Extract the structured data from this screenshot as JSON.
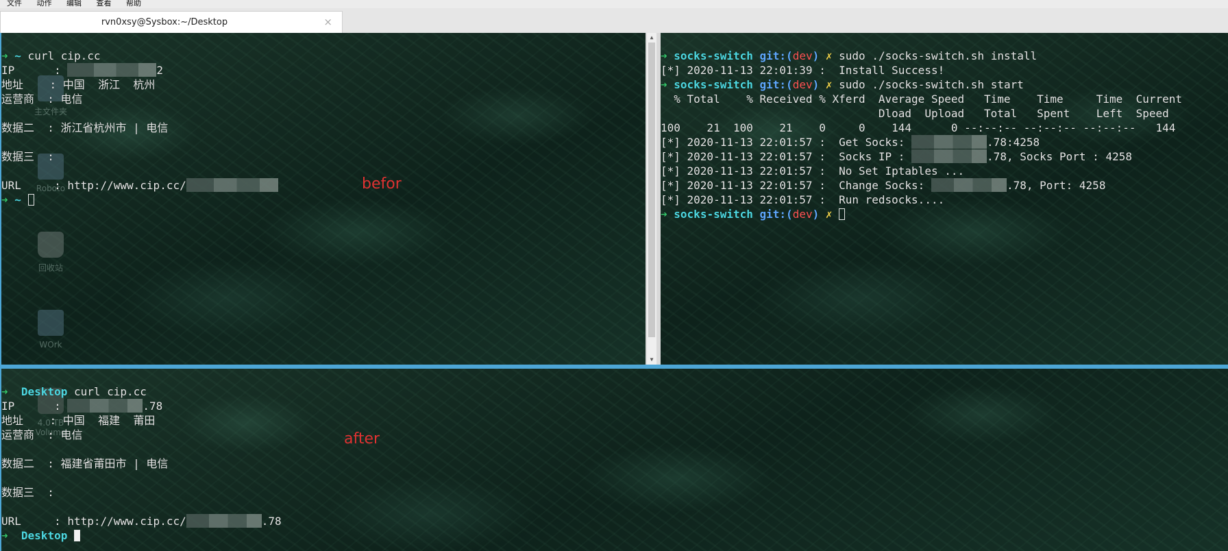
{
  "menu": [
    "文件",
    "动作",
    "编辑",
    "查看",
    "帮助"
  ],
  "window": {
    "tab_title": "rvn0xsy@Sysbox:~/Desktop",
    "close_glyph": "×"
  },
  "desktop_icons": [
    "主文件夹",
    "Roboto",
    "回收站",
    "WOrk",
    "4.0 TB Volume"
  ],
  "annotations": {
    "before": "befor",
    "after": "after"
  },
  "panes": {
    "top_left": {
      "l1": {
        "arrow": "➜",
        "dir": "~",
        "cmd": " curl cip.cc"
      },
      "l2": {
        "key": "IP      : ",
        "tail": "2"
      },
      "l3": "地址    : 中国  浙江  杭州",
      "l4": "运营商  : 电信",
      "l6": "数据二  : 浙江省杭州市 | 电信",
      "l8": "数据三  :",
      "l10": {
        "key": "URL     : http://www.cip.cc/"
      },
      "l11": {
        "arrow": "➜",
        "dir": "~"
      }
    },
    "top_right": {
      "l1": {
        "arrow": "➜",
        "dir": "socks-switch",
        "git": "git:(",
        "branch": "dev",
        "git_close": ")",
        "dirty": "✗",
        "cmd": " sudo ./socks-switch.sh install"
      },
      "l2": "[*] 2020-11-13 22:01:39 :  Install Success!",
      "l3": {
        "cmd": " sudo ./socks-switch.sh start"
      },
      "l4": "  % Total    % Received % Xferd  Average Speed   Time    Time     Time  Current",
      "l5": "                                 Dload  Upload   Total   Spent    Left  Speed",
      "l6": "100    21  100    21    0     0    144      0 --:--:-- --:--:-- --:--:--   144",
      "l7": {
        "pre": "[*] 2020-11-13 22:01:57 :  Get Socks: ",
        "post": ".78:4258"
      },
      "l8": {
        "pre": "[*] 2020-11-13 22:01:57 :  Socks IP : ",
        "post": ".78, Socks Port : 4258"
      },
      "l9": "[*] 2020-11-13 22:01:57 :  No Set Iptables ...",
      "l10": {
        "pre": "[*] 2020-11-13 22:01:57 :  Change Socks: ",
        "post": ".78, Port: 4258"
      },
      "l11": "[*] 2020-11-13 22:01:57 :  Run redsocks...."
    },
    "bottom": {
      "l1": {
        "arrow": "➜",
        "dir": "Desktop",
        "cmd": " curl cip.cc"
      },
      "l2": {
        "key": "IP      : ",
        "tail": ".78"
      },
      "l3": "地址    : 中国  福建  莆田",
      "l4": "运营商  : 电信",
      "l6": "数据二  : 福建省莆田市 | 电信",
      "l8": "数据三  :",
      "l10": {
        "key": "URL     : http://www.cip.cc/",
        "tail": ".78"
      },
      "l11": {
        "arrow": "➜",
        "dir": "Desktop"
      }
    }
  },
  "colors": {
    "prompt_arrow": "#35c46a",
    "prompt_dir": "#4dd8e2",
    "git_label": "#5fa8ff",
    "branch": "#ff5555",
    "dirty": "#f0d24a",
    "annotation": "#e03232",
    "split_border": "#4da6d6"
  }
}
